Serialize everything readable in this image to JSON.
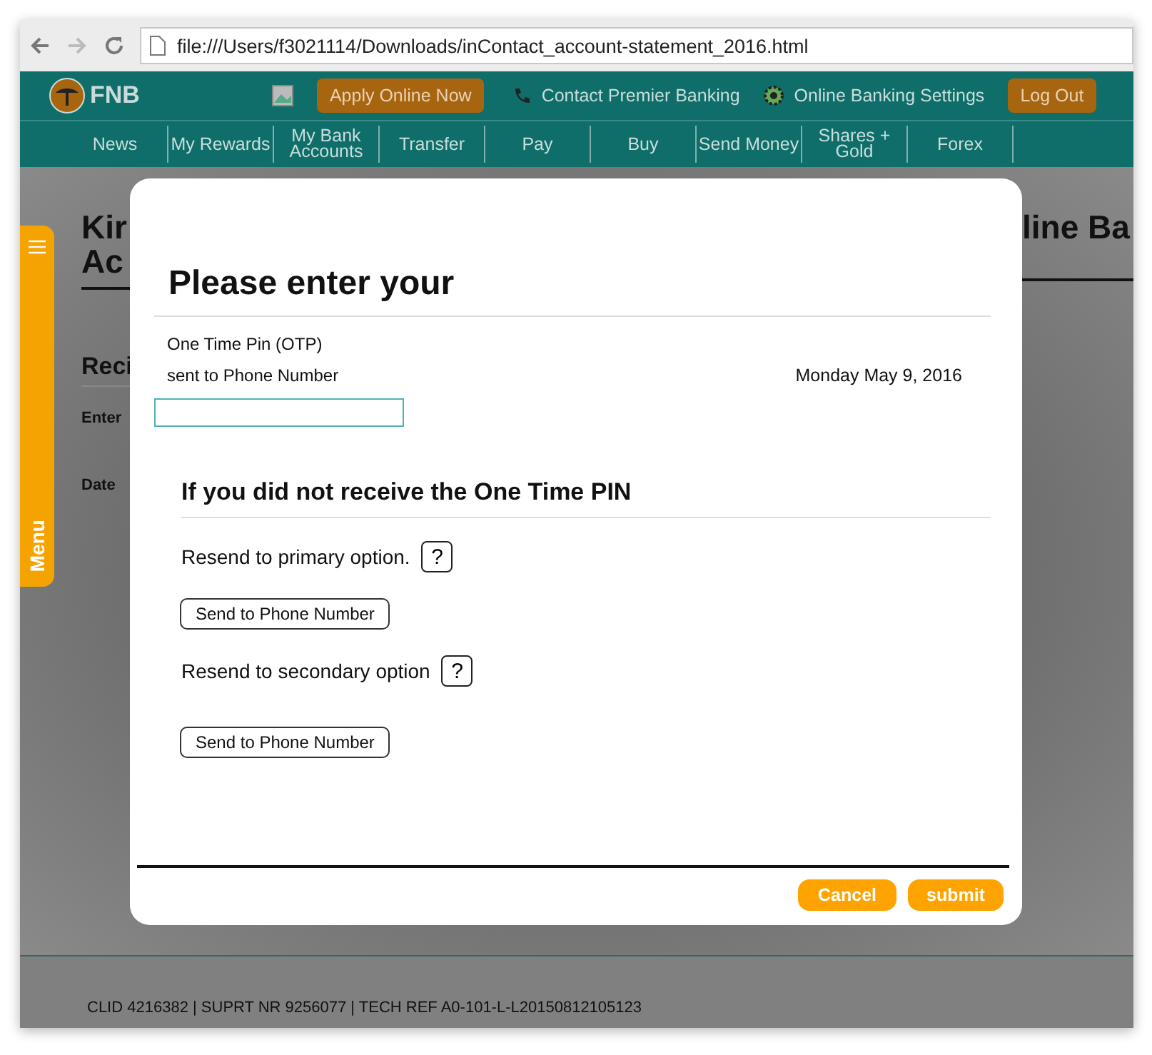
{
  "browser": {
    "address": "file:///Users/f3021114/Downloads/inContact_account-statement_2016.html"
  },
  "header": {
    "logo": "FNB",
    "apply_button": "Apply Online Now",
    "contact": "Contact Premier Banking",
    "settings": "Online Banking Settings",
    "logout": "Log Out"
  },
  "nav": [
    "News",
    "My Rewards",
    "My Bank Accounts",
    "Transfer",
    "Pay",
    "Buy",
    "Send Money",
    "Shares + Gold",
    "Forex"
  ],
  "side_menu": {
    "label": "Menu"
  },
  "page": {
    "title_left": [
      "Kir",
      "Ac"
    ],
    "title_right": "line Ba",
    "section": "Reci",
    "fields": [
      "Enter",
      "Date"
    ]
  },
  "dialog": {
    "title": "Please enter your",
    "otp_label": "One Time Pin (OTP)",
    "sent_label": "sent to Phone Number",
    "date": "Monday May 9, 2016",
    "otp_input": {
      "kind": "field"
    },
    "resend_heading": "If you did not receive the One Time PIN",
    "options": [
      {
        "label": "Resend to primary option.",
        "help": "?",
        "button": "Send to Phone Number"
      },
      {
        "label": "Resend to secondary option",
        "help": "?",
        "button": "Send to Phone Number"
      }
    ],
    "buttons": [
      "Cancel",
      "submit"
    ]
  },
  "footer": "CLID 4216382 | SUPRT NR 9256077 | TECH REF A0-101-L-L20150812105123"
}
